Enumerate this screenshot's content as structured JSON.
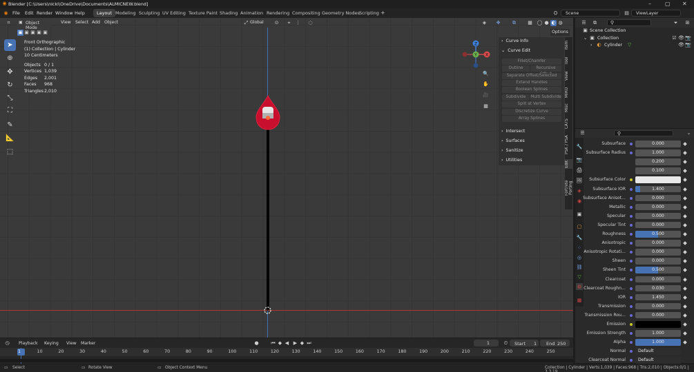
{
  "window": {
    "title": "Blender [C:\\Users\\nicki\\OneDrive\\Documents\\ALMICNEW.blend]",
    "controls": [
      "–",
      "▢",
      "✕"
    ]
  },
  "menu": {
    "items": [
      "File",
      "Edit",
      "Render",
      "Window",
      "Help"
    ],
    "workspaces": [
      "Layout",
      "Modeling",
      "Sculpting",
      "UV Editing",
      "Texture Paint",
      "Shading",
      "Animation",
      "Rendering",
      "Compositing",
      "Geometry Nodes",
      "Scripting"
    ],
    "add_tab": "+",
    "scene": "Scene",
    "view_layer": "ViewLayer"
  },
  "viewport_header": {
    "mode": "Object Mode",
    "menus": [
      "View",
      "Select",
      "Add",
      "Object"
    ],
    "transform": "Global",
    "options": "Options"
  },
  "viewport_info": {
    "view": "Front Orthographic",
    "collection": "(1) Collection | Cylinder",
    "scale": "10 Centimeters",
    "stats": [
      {
        "label": "Objects",
        "value": "0 / 1"
      },
      {
        "label": "Vertices",
        "value": "1,039"
      },
      {
        "label": "Edges",
        "value": "2,001"
      },
      {
        "label": "Faces",
        "value": "968"
      },
      {
        "label": "Triangles",
        "value": "2,010"
      }
    ]
  },
  "gizmo": {
    "z": "Z",
    "y": "Y",
    "x": "X"
  },
  "npanel": {
    "sections": {
      "curve_info": "Curve Info",
      "curve_edit": "Curve Edit",
      "intersect": "Intersect",
      "surfaces": "Surfaces",
      "sanitize": "Sanitize",
      "utilities": "Utilities"
    },
    "buttons": {
      "fillet": "Fillet/Chamfer",
      "outline": "Outline",
      "recursive_offset": "Recursive Offset",
      "separate_offset": "Separate Offset/Selected",
      "extend_handles": "Extend Handles",
      "boolean_splines": "Boolean Splines",
      "subdivide": "Subdivide",
      "multi_subdivide": "Multi Subdivide",
      "split_at_vertex": "Split at Vertex",
      "discretize_curve": "Discretize Curve",
      "array_splines": "Array Splines"
    },
    "tabs": [
      "Item",
      "Tool",
      "View",
      "MIRO",
      "Misc",
      "CATS",
      "PSK / PSA",
      "Edit",
      "Fortnite Porting"
    ]
  },
  "outliner": {
    "scene_collection": "Scene Collection",
    "collection": "Collection",
    "object": "Cylinder"
  },
  "properties": {
    "rows": [
      {
        "label": "Subsurface",
        "value": "0.000",
        "fill": 0
      },
      {
        "label": "Subsurface Radius",
        "value": "1.000",
        "fill": 0
      },
      {
        "label": "",
        "value": "0.200",
        "fill": 0
      },
      {
        "label": "",
        "value": "0.100",
        "fill": 0
      },
      {
        "label": "Subsurface Color",
        "value": "",
        "color": "#e8e8e8"
      },
      {
        "label": "Subsurface IOR",
        "value": "1.400",
        "fill": 0.1
      },
      {
        "label": "Subsurface Anisot...",
        "value": "0.000",
        "fill": 0
      },
      {
        "label": "Metallic",
        "value": "0.000",
        "fill": 0
      },
      {
        "label": "Specular",
        "value": "0.000",
        "fill": 0
      },
      {
        "label": "Specular Tint",
        "value": "0.000",
        "fill": 0
      },
      {
        "label": "Roughness",
        "value": "0.500",
        "fill": 0.5
      },
      {
        "label": "Anisotropic",
        "value": "0.000",
        "fill": 0
      },
      {
        "label": "Anisotropic Rotati...",
        "value": "0.000",
        "fill": 0
      },
      {
        "label": "Sheen",
        "value": "0.000",
        "fill": 0
      },
      {
        "label": "Sheen Tint",
        "value": "0.500",
        "fill": 0.5
      },
      {
        "label": "Clearcoat",
        "value": "0.000",
        "fill": 0
      },
      {
        "label": "Clearcoat Roughn...",
        "value": "0.030",
        "fill": 0
      },
      {
        "label": "IOR",
        "value": "1.450",
        "fill": 0
      },
      {
        "label": "Transmission",
        "value": "0.000",
        "fill": 0
      },
      {
        "label": "Transmission Rou...",
        "value": "0.000",
        "fill": 0
      },
      {
        "label": "Emission",
        "value": "",
        "color": "#000000"
      },
      {
        "label": "Emission Strength",
        "value": "1.000",
        "fill": 0
      },
      {
        "label": "Alpha",
        "value": "1.000",
        "fill": 1
      },
      {
        "label": "Normal",
        "value": "Default",
        "fill": 0
      },
      {
        "label": "Clearcoat Normal",
        "value": "Default",
        "fill": 0
      }
    ]
  },
  "timeline": {
    "menus": [
      "Playback",
      "Keying",
      "View",
      "Marker"
    ],
    "current_frame": "1",
    "start_label": "Start",
    "start": "1",
    "end_label": "End",
    "end": "250",
    "ticks": [
      "1",
      "10",
      "20",
      "30",
      "40",
      "50",
      "60",
      "70",
      "80",
      "90",
      "100",
      "110",
      "120",
      "130",
      "140",
      "150",
      "160",
      "170",
      "180",
      "190",
      "200",
      "210",
      "220",
      "230",
      "240",
      "250"
    ]
  },
  "status": {
    "select": "Select",
    "rotate": "Rotate View",
    "context": "Object Context Menu",
    "info": "Collection | Cylinder | Verts:1,039 | Faces:968 | Tris:2,010 | Objects:0/1 | 3.3.19"
  },
  "colors": {
    "accent": "#4772b3",
    "object_red": "#c8102e",
    "x_axis": "#d94a4a",
    "y_axis": "#6ab04c",
    "z_axis": "#3f7fd6"
  }
}
